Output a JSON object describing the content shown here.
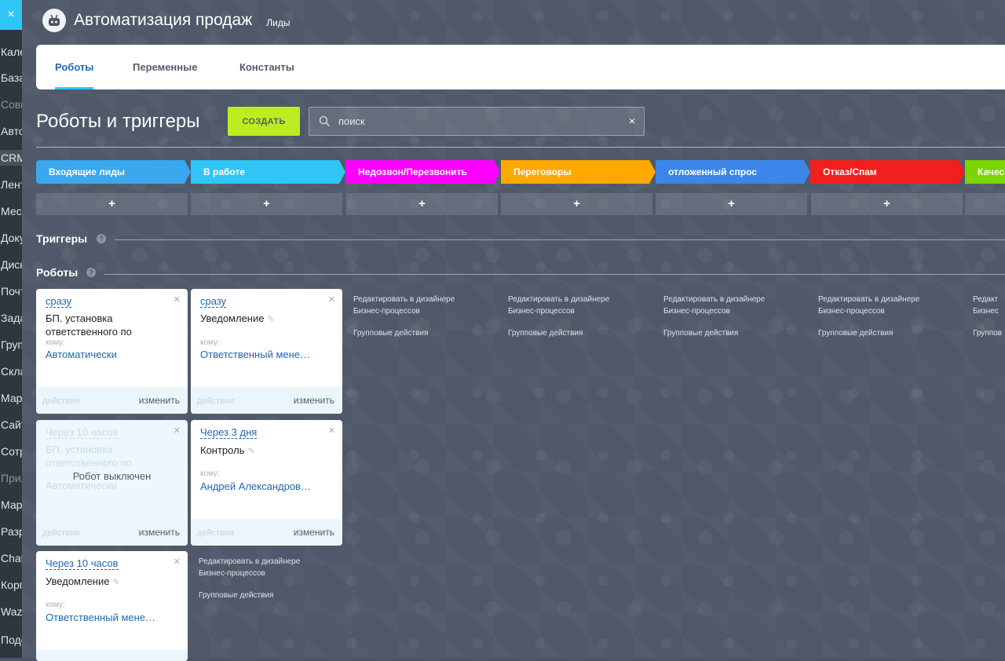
{
  "sidebar": {
    "close_icon": "×",
    "items": [
      "Кале",
      "База",
      "Совм",
      "Авто",
      "CRM",
      "Лент",
      "Месс",
      "Доку",
      "Диск",
      "Почт",
      "Зада",
      "Груп",
      "Скла",
      "Марк",
      "Сайт",
      "Сотр",
      "Прил",
      "Марк",
      "Разр",
      "Chat",
      "Корп",
      "Wazz",
      "Подо"
    ]
  },
  "header": {
    "title": "Автоматизация продаж",
    "subtitle": "Лиды"
  },
  "tabs": [
    "Роботы",
    "Переменные",
    "Константы"
  ],
  "page_title": "Роботы и триггеры",
  "create_label": "СОЗДАТЬ",
  "search": {
    "placeholder": "поиск",
    "clear": "×"
  },
  "stages": [
    {
      "label": "Входящие лиды",
      "color": "#39a8ef"
    },
    {
      "label": "В работе",
      "color": "#2fc6f6"
    },
    {
      "label": "Недозвон/Перезвонить",
      "color": "#ff00ff"
    },
    {
      "label": "Переговоры",
      "color": "#ffa900"
    },
    {
      "label": "отложенный спрос",
      "color": "#3b86e8"
    },
    {
      "label": "Отказ/Спам",
      "color": "#f21f1f"
    },
    {
      "label": "Качес",
      "color": "#7bd500"
    }
  ],
  "plus": "+",
  "triggers_label": "Триггеры",
  "robots_label": "Роботы",
  "help": "?",
  "cards": {
    "c1": {
      "delay": "сразу",
      "name": "БП. установка ответственного по",
      "to_label": "кому:",
      "to_value": "Автоматически",
      "actions": "действия",
      "edit": "изменить"
    },
    "c2": {
      "delay": "сразу",
      "name": "Уведомление",
      "to_label": "кому:",
      "to_value": "Ответственный мене…",
      "actions": "действия",
      "edit": "изменить"
    },
    "c3": {
      "delay": "Через 10 часов",
      "name": "БП. установка ответственного по",
      "to_value": "Автоматически",
      "off": "Робот выключен",
      "actions": "действия",
      "edit": "изменить"
    },
    "c4": {
      "delay": "Через 3 дня",
      "name": "Контроль",
      "to_label": "кому:",
      "to_value": "Андрей Александров…",
      "actions": "действия",
      "edit": "изменить"
    },
    "c5": {
      "delay": "Через 10 часов",
      "name": "Уведомление",
      "to_label": "кому:",
      "to_value": "Ответственный мене…"
    }
  },
  "column_links": {
    "designer": "Редактировать в дизайнере Бизнес-процессов",
    "group": "Групповые действия",
    "designer_cut": "Редакт Бизнес",
    "group_cut": "Группов"
  }
}
